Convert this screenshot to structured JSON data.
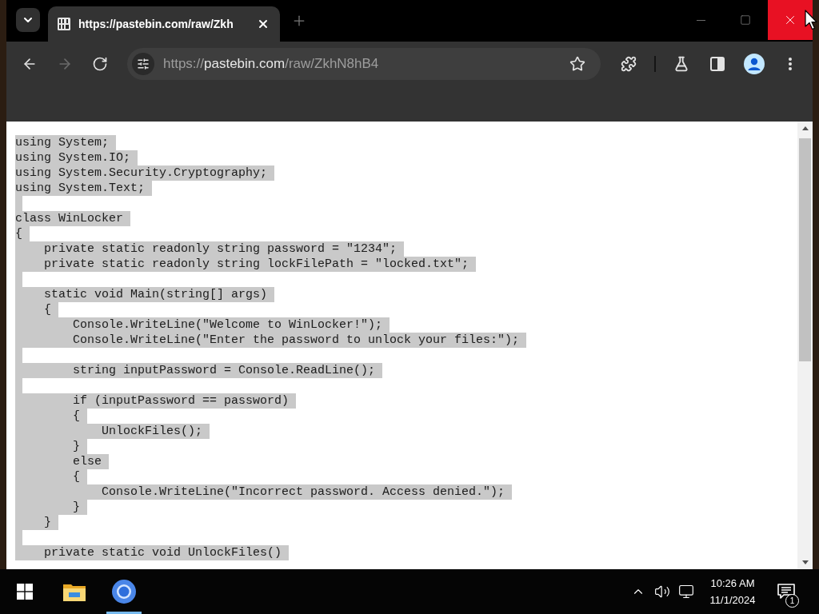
{
  "window": {
    "controls": {
      "close_hovered": true
    }
  },
  "tabs": [
    {
      "title": "https://pastebin.com/raw/Zkh",
      "selected": true
    }
  ],
  "toolbar": {
    "nav_buttons": [
      {
        "kind": "back",
        "disabled": false
      },
      {
        "kind": "forward",
        "disabled": true
      },
      {
        "kind": "reload",
        "disabled": false
      }
    ],
    "address": {
      "scheme": "https://",
      "host": "pastebin.com",
      "path": "/raw/ZkhN8hB4"
    },
    "bookmarked": false
  },
  "page": {
    "selected": true,
    "blocks": [
      [
        "using System;",
        "using System.IO;",
        "using System.Security.Cryptography;",
        "using System.Text;"
      ],
      [
        "class WinLocker",
        "{",
        "    private static readonly string password = \"1234\";",
        "    private static readonly string lockFilePath = \"locked.txt\";"
      ],
      [
        "    static void Main(string[] args)",
        "    {",
        "        Console.WriteLine(\"Welcome to WinLocker!\");",
        "        Console.WriteLine(\"Enter the password to unlock your files:\");"
      ],
      [
        "        string inputPassword = Console.ReadLine();"
      ],
      [
        "        if (inputPassword == password)",
        "        {",
        "            UnlockFiles();",
        "        }",
        "        else",
        "        {",
        "            Console.WriteLine(\"Incorrect password. Access denied.\");",
        "        }",
        "    }"
      ],
      [
        "    private static void UnlockFiles()"
      ]
    ]
  },
  "taskbar": {
    "apps": [
      {
        "kind": "file_explorer",
        "selected": false
      },
      {
        "kind": "browser",
        "selected": true
      }
    ],
    "clock": {
      "time": "10:26 AM",
      "date": "11/1/2024"
    },
    "notification_count": "1"
  }
}
